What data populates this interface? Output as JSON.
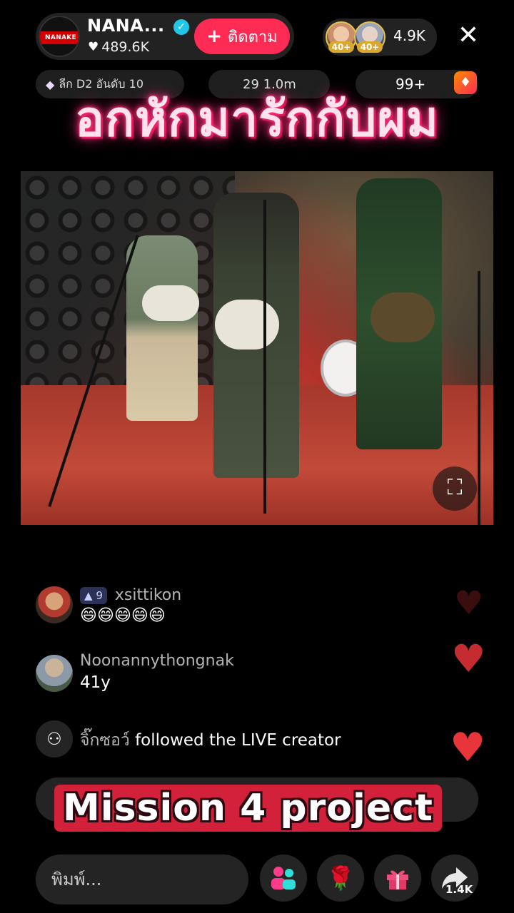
{
  "header": {
    "host_name": "NANA...",
    "host_brand": "NANAKE",
    "likes": "489.6K",
    "follow_label": "ติดตาม",
    "viewer_levels": [
      "40+",
      "40+"
    ],
    "viewer_count": "4.9K"
  },
  "subheader": {
    "rank_text": "ลีก D2 อันดับ 10",
    "score_text": "29 1.0m",
    "count_text": "99+"
  },
  "overlay_title": "อกหักมารักกับผม",
  "comments": [
    {
      "level": "9",
      "user": "xsittikon",
      "text": "😄😄😄😄😄"
    },
    {
      "user": "Noonannythongnak",
      "text": "41y"
    }
  ],
  "follow_notice": {
    "user": "จิ๊กซอว์",
    "text": "followed the LIVE creator"
  },
  "mission_title": "Mission 4 project",
  "bottom_bar": {
    "input_placeholder": "พิมพ์...",
    "share_count": "1.4K"
  },
  "colors": {
    "accent": "#fe2c55",
    "heart": "#e8343b",
    "neon_pink": "#ff2d7a",
    "verified": "#20c7e8"
  },
  "icons": [
    "verified-icon",
    "heart-icon",
    "plus-icon",
    "close-icon",
    "diamond-icon",
    "expand-icon",
    "user-follow-icon",
    "people-icon",
    "rose-icon",
    "gift-icon",
    "share-icon"
  ]
}
